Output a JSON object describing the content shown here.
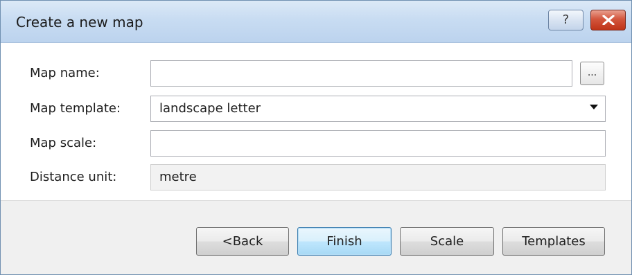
{
  "dialog": {
    "title": "Create a new map",
    "help_glyph": "?",
    "close_icon": "close-icon"
  },
  "form": {
    "map_name": {
      "label": "Map name:",
      "value": "",
      "browse_label": "..."
    },
    "map_template": {
      "label": "Map template:",
      "value": "landscape letter"
    },
    "map_scale": {
      "label": "Map scale:",
      "value": ""
    },
    "distance_unit": {
      "label": "Distance unit:",
      "value": "metre"
    }
  },
  "buttons": {
    "back": "<Back",
    "finish": "Finish",
    "scale": "Scale",
    "templates": "Templates"
  },
  "colors": {
    "titlebar": "#c8dcf2",
    "close_button": "#c9452a",
    "default_button_border": "#3c7fb1"
  }
}
